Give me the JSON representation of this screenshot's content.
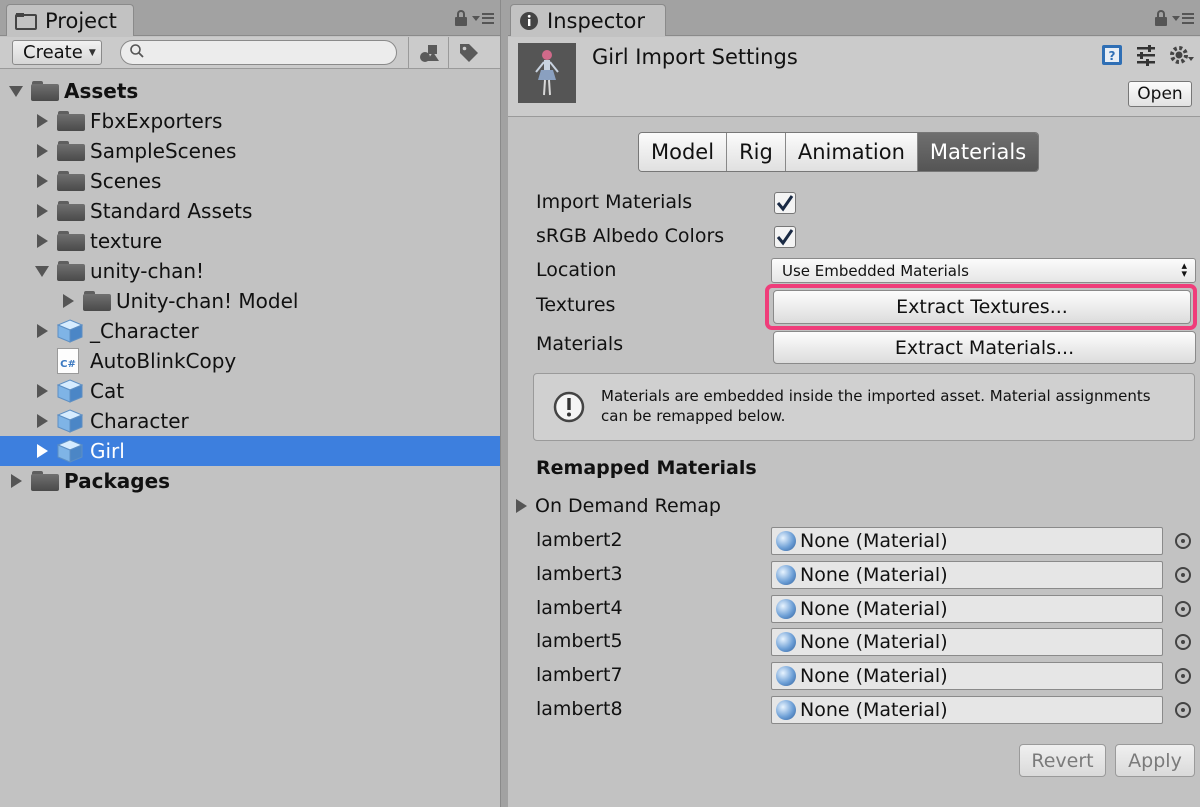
{
  "project": {
    "tab_label": "Project",
    "create_label": "Create",
    "search_placeholder": "",
    "tree": [
      {
        "label": "Assets",
        "bold": true,
        "fold": "open",
        "icon": "folder"
      },
      {
        "label": "FbxExporters",
        "fold": "closed",
        "icon": "folder"
      },
      {
        "label": "SampleScenes",
        "fold": "closed",
        "icon": "folder"
      },
      {
        "label": "Scenes",
        "fold": "closed",
        "icon": "folder"
      },
      {
        "label": "Standard Assets",
        "fold": "closed",
        "icon": "folder"
      },
      {
        "label": "texture",
        "fold": "closed",
        "icon": "folder"
      },
      {
        "label": "unity-chan!",
        "fold": "open",
        "icon": "folder"
      },
      {
        "label": "Unity-chan! Model",
        "fold": "closed",
        "icon": "folder"
      },
      {
        "label": "_Character",
        "fold": "closed",
        "icon": "model-cube"
      },
      {
        "label": "AutoBlinkCopy",
        "fold": "none",
        "icon": "csharp-script"
      },
      {
        "label": "Cat",
        "fold": "closed",
        "icon": "model-cube"
      },
      {
        "label": "Character",
        "fold": "closed",
        "icon": "model-cube"
      },
      {
        "label": "Girl",
        "fold": "closed",
        "icon": "model-cube",
        "selected": true
      },
      {
        "label": "Packages",
        "bold": true,
        "fold": "closed",
        "icon": "folder"
      }
    ]
  },
  "inspector": {
    "tab_label": "Inspector",
    "title": "Girl Import Settings",
    "open_label": "Open",
    "tabs": [
      "Model",
      "Rig",
      "Animation",
      "Materials"
    ],
    "active_tab": "Materials",
    "import_materials_label": "Import Materials",
    "import_materials_checked": true,
    "srgb_label": "sRGB Albedo Colors",
    "srgb_checked": true,
    "location_label": "Location",
    "location_value": "Use Embedded Materials",
    "textures_label": "Textures",
    "extract_textures_label": "Extract Textures...",
    "materials_label": "Materials",
    "extract_materials_label": "Extract Materials...",
    "help_text": "Materials are embedded inside the imported asset. Material assignments can be remapped below.",
    "remapped_header": "Remapped Materials",
    "on_demand_label": "On Demand Remap",
    "remaps": [
      {
        "name": "lambert2",
        "value": "None (Material)"
      },
      {
        "name": "lambert3",
        "value": "None (Material)"
      },
      {
        "name": "lambert4",
        "value": "None (Material)"
      },
      {
        "name": "lambert5",
        "value": "None (Material)"
      },
      {
        "name": "lambert7",
        "value": "None (Material)"
      },
      {
        "name": "lambert8",
        "value": "None (Material)"
      }
    ],
    "revert_label": "Revert",
    "apply_label": "Apply"
  },
  "colors": {
    "selection": "#3d7fde",
    "highlight": "#ef3d7a",
    "panel_bg": "#c2c2c2"
  }
}
